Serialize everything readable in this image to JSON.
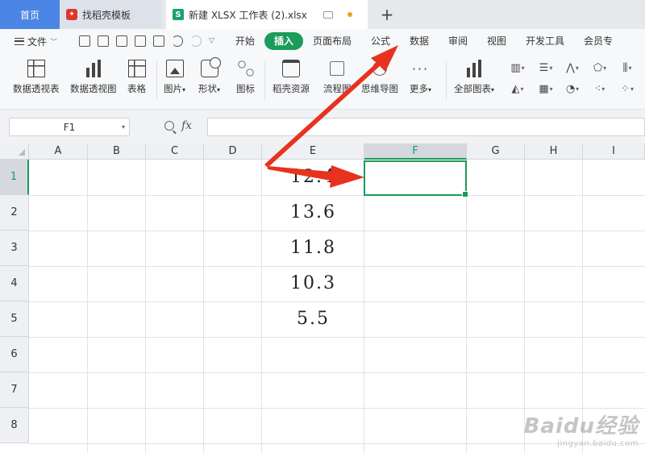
{
  "tabs": {
    "home": "首页",
    "template": "找稻壳模板",
    "file": "新建 XLSX 工作表 (2).xlsx",
    "new_tab": "+"
  },
  "menu": {
    "file_label": "文件",
    "items": [
      "开始",
      "插入",
      "页面布局",
      "公式",
      "数据",
      "审阅",
      "视图",
      "开发工具",
      "会员专"
    ],
    "active": "插入"
  },
  "ribbon": {
    "pivot_table": "数据透视表",
    "pivot_chart": "数据透视图",
    "table": "表格",
    "picture": "图片",
    "shape": "形状",
    "icons": "图标",
    "docer_resources": "稻壳资源",
    "flowchart": "流程图",
    "mind_map": "思维导图",
    "more": "更多",
    "all_charts": "全部图表",
    "dropdown_caret": "▾"
  },
  "formula_bar": {
    "name_box": "F1",
    "fx": "fx",
    "formula": ""
  },
  "sheet": {
    "columns": [
      "A",
      "B",
      "C",
      "D",
      "E",
      "F",
      "G",
      "H",
      "I"
    ],
    "selected_column": "F",
    "rows": [
      "1",
      "2",
      "3",
      "4",
      "5",
      "6",
      "7",
      "8"
    ],
    "selected_row": "1",
    "column_e_values": [
      "12.4",
      "13.6",
      "11.8",
      "10.3",
      "5.5"
    ]
  },
  "watermark": {
    "main": "Baidu经验",
    "sub": "jingyan.baidu.com"
  },
  "colors": {
    "accent_green": "#1a9c5a",
    "home_tab_blue": "#4b86e6",
    "annotation_red": "#e8321e"
  }
}
